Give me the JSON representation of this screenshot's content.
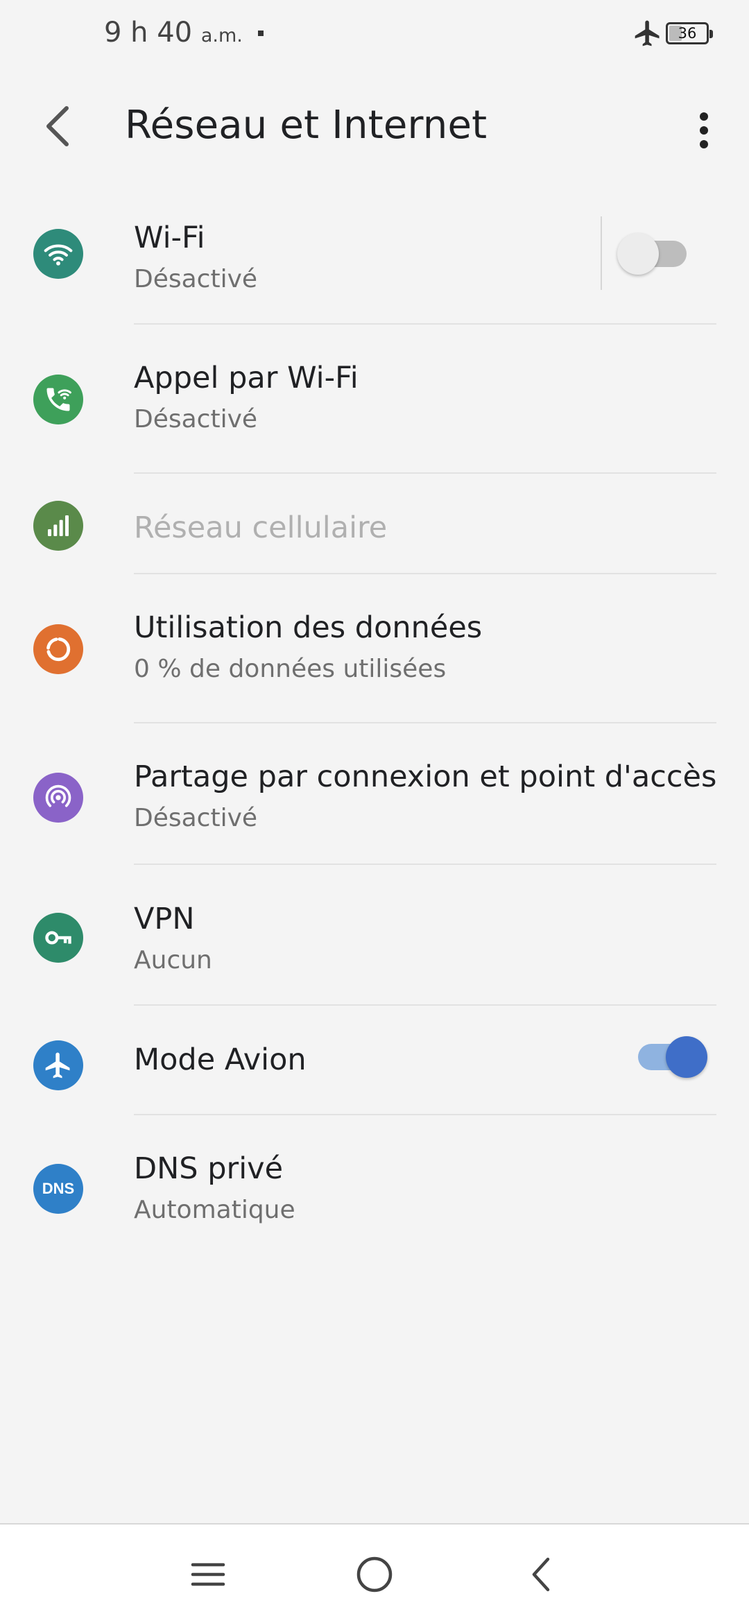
{
  "status_bar": {
    "time": "9 h 40",
    "ampm": "a.m.",
    "battery_level": "36",
    "battery_fraction": 0.36
  },
  "app_bar": {
    "title": "Réseau et Internet",
    "back_icon": "arrow-back-icon",
    "more_icon": "more-vert-icon"
  },
  "items": [
    {
      "key": "wifi",
      "title": "Wi-Fi",
      "summary": "Désactivé",
      "icon": "wifi-icon",
      "icon_color": "#2e8b7a",
      "toggle": false,
      "enabled": true
    },
    {
      "key": "wifi_calling",
      "title": "Appel par Wi-Fi",
      "summary": "Désactivé",
      "icon": "wifi-calling-icon",
      "icon_color": "#3ea05a",
      "enabled": true
    },
    {
      "key": "cellular",
      "title": "Réseau cellulaire",
      "summary": "",
      "icon": "signal-icon",
      "icon_color": "#5a8a4a",
      "enabled": false
    },
    {
      "key": "data_usage",
      "title": "Utilisation des données",
      "summary": "0 % de données utilisées",
      "icon": "data-usage-icon",
      "icon_color": "#e07030",
      "enabled": true
    },
    {
      "key": "hotspot",
      "title": "Partage par connexion et point d'accès",
      "summary": "Désactivé",
      "icon": "hotspot-icon",
      "icon_color": "#8a63c8",
      "enabled": true
    },
    {
      "key": "vpn",
      "title": "VPN",
      "summary": "Aucun",
      "icon": "vpn-key-icon",
      "icon_color": "#2e8b6a",
      "enabled": true
    },
    {
      "key": "airplane",
      "title": "Mode Avion",
      "summary": "",
      "icon": "airplane-icon",
      "icon_color": "#2f80c8",
      "toggle": true,
      "enabled": true
    },
    {
      "key": "dns",
      "title": "DNS privé",
      "summary": "Automatique",
      "icon": "dns-icon",
      "icon_label": "DNS",
      "icon_color": "#2f80c8",
      "enabled": true
    }
  ],
  "nav_bar": {
    "recents_icon": "menu-icon",
    "home_icon": "home-circle-icon",
    "back_icon": "nav-back-icon"
  },
  "colors": {
    "background": "#f4f4f4",
    "toggle_on_thumb": "#3f6ec8",
    "toggle_on_track": "#8fb3e0",
    "toggle_off_track": "#bdbdbd"
  }
}
